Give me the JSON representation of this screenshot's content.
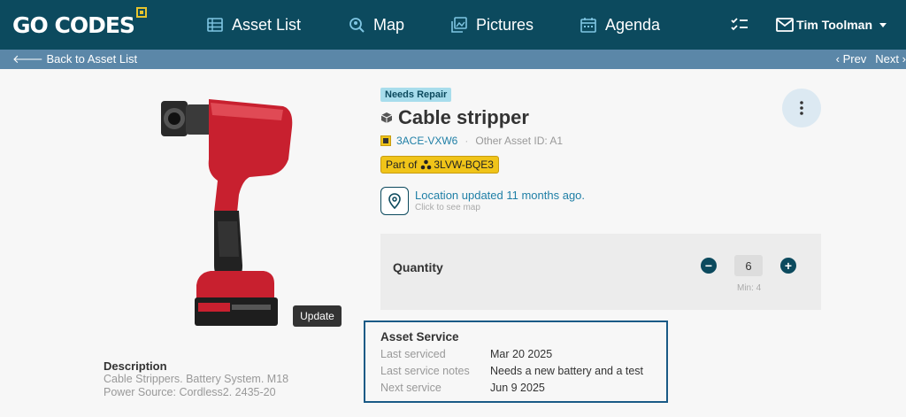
{
  "nav": {
    "logo": "GO CODES",
    "items": [
      {
        "label": "Asset List",
        "icon": "list-icon"
      },
      {
        "label": "Map",
        "icon": "map-search-icon"
      },
      {
        "label": "Pictures",
        "icon": "pictures-icon"
      },
      {
        "label": "Agenda",
        "icon": "calendar-icon"
      }
    ],
    "right_icons": [
      "checklist-icon",
      "mail-icon"
    ],
    "user": "Tim Toolman"
  },
  "subbar": {
    "back": "Back to Asset List",
    "prev": "Prev",
    "next": "Next"
  },
  "asset": {
    "status_badge": "Needs Repair",
    "name": "Cable stripper",
    "code": "3ACE-VXW6",
    "other_id": "Other Asset ID: A1",
    "part_of_label": "Part of",
    "part_of_code": "3LVW-BQE3",
    "location_text": "Location updated 11 months ago.",
    "location_sub": "Click to see map",
    "update_button": "Update",
    "description_title": "Description",
    "description": "Cable Strippers. Battery System. M18 Power Source: Cordless2. 2435-20"
  },
  "quantity": {
    "label": "Quantity",
    "value": "6",
    "min": "Min: 4",
    "minus": "−",
    "plus": "+"
  },
  "service": {
    "title": "Asset Service",
    "rows": [
      {
        "key": "Last serviced",
        "value": "Mar 20 2025"
      },
      {
        "key": "Last service notes",
        "value": "Needs a new battery and a test"
      },
      {
        "key": "Next service",
        "value": "Jun 9 2025"
      }
    ]
  },
  "colors": {
    "nav_bg": "#0c4a5e",
    "subbar_bg": "#5b87a8",
    "badge_bg": "#a8ddec",
    "part_of_bg": "#f0c419",
    "link": "#1f7fa6",
    "service_border": "#1a5a86"
  }
}
